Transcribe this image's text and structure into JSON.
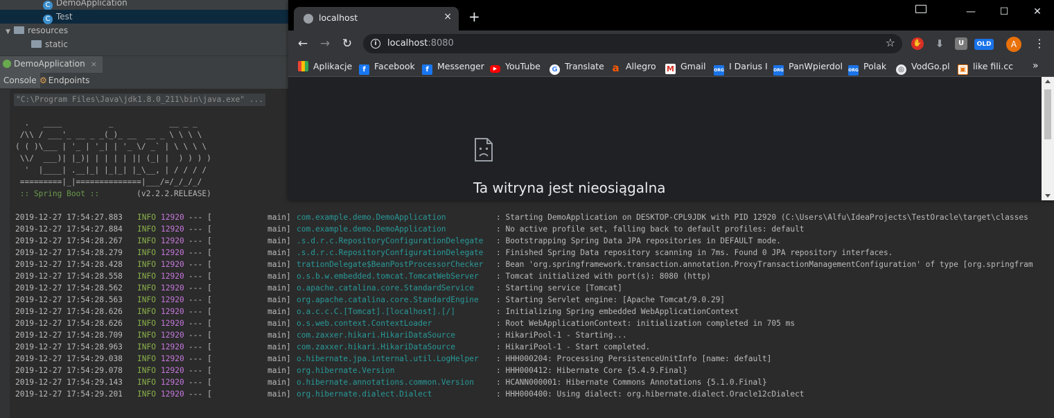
{
  "ide": {
    "project_tree": [
      {
        "label": "DemoApplication",
        "type": "class"
      },
      {
        "label": "Test",
        "type": "class",
        "selected": true
      },
      {
        "label": "resources",
        "type": "folder",
        "expanded": true
      },
      {
        "label": "static",
        "type": "folder"
      }
    ],
    "run_tab": {
      "label": "DemoApplication",
      "close": "×"
    },
    "tool_tabs": {
      "console": "Console",
      "endpoints": "Endpoints"
    },
    "console": {
      "command": "\"C:\\Program Files\\Java\\jdk1.8.0_211\\bin\\java.exe\" ...",
      "banner": [
        "  .   ____          _            __ _ _",
        " /\\\\ / ___'_ __ _ _(_)_ __  __ _ \\ \\ \\ \\",
        "( ( )\\___ | '_ | '_| | '_ \\/ _` | \\ \\ \\ \\",
        " \\\\/  ___)| |_)| | | | | || (_| |  ) ) ) )",
        "  '  |____| .__|_| |_|_| |_\\__, | / / / /",
        " =========|_|==============|___/=/_/_/_/"
      ],
      "spring_label": " :: Spring Boot :: ",
      "spring_version": "       (v2.2.2.RELEASE)",
      "logs": [
        {
          "ts": "2019-12-27 17:54:27.883",
          "level": "INFO",
          "pid": "12920",
          "sep": "--- [",
          "thread": "main]",
          "logger": "com.example.demo.DemoApplication",
          "msg": ": Starting DemoApplication on DESKTOP-CPL9JDK with PID 12920 (C:\\Users\\Alfu\\IdeaProjects\\TestOracle\\target\\classes"
        },
        {
          "ts": "2019-12-27 17:54:27.884",
          "level": "INFO",
          "pid": "12920",
          "sep": "--- [",
          "thread": "main]",
          "logger": "com.example.demo.DemoApplication",
          "msg": ": No active profile set, falling back to default profiles: default"
        },
        {
          "ts": "2019-12-27 17:54:28.267",
          "level": "INFO",
          "pid": "12920",
          "sep": "--- [",
          "thread": "main]",
          "logger": ".s.d.r.c.RepositoryConfigurationDelegate",
          "msg": ": Bootstrapping Spring Data JPA repositories in DEFAULT mode."
        },
        {
          "ts": "2019-12-27 17:54:28.279",
          "level": "INFO",
          "pid": "12920",
          "sep": "--- [",
          "thread": "main]",
          "logger": ".s.d.r.c.RepositoryConfigurationDelegate",
          "msg": ": Finished Spring Data repository scanning in 7ms. Found 0 JPA repository interfaces."
        },
        {
          "ts": "2019-12-27 17:54:28.428",
          "level": "INFO",
          "pid": "12920",
          "sep": "--- [",
          "thread": "main]",
          "logger": "trationDelegate$BeanPostProcessorChecker",
          "msg": ": Bean 'org.springframework.transaction.annotation.ProxyTransactionManagementConfiguration' of type [org.springfram"
        },
        {
          "ts": "2019-12-27 17:54:28.558",
          "level": "INFO",
          "pid": "12920",
          "sep": "--- [",
          "thread": "main]",
          "logger": "o.s.b.w.embedded.tomcat.TomcatWebServer",
          "msg": ": Tomcat initialized with port(s): 8080 (http)"
        },
        {
          "ts": "2019-12-27 17:54:28.562",
          "level": "INFO",
          "pid": "12920",
          "sep": "--- [",
          "thread": "main]",
          "logger": "o.apache.catalina.core.StandardService",
          "msg": ": Starting service [Tomcat]"
        },
        {
          "ts": "2019-12-27 17:54:28.563",
          "level": "INFO",
          "pid": "12920",
          "sep": "--- [",
          "thread": "main]",
          "logger": "org.apache.catalina.core.StandardEngine",
          "msg": ": Starting Servlet engine: [Apache Tomcat/9.0.29]"
        },
        {
          "ts": "2019-12-27 17:54:28.626",
          "level": "INFO",
          "pid": "12920",
          "sep": "--- [",
          "thread": "main]",
          "logger": "o.a.c.c.C.[Tomcat].[localhost].[/]",
          "msg": ": Initializing Spring embedded WebApplicationContext"
        },
        {
          "ts": "2019-12-27 17:54:28.626",
          "level": "INFO",
          "pid": "12920",
          "sep": "--- [",
          "thread": "main]",
          "logger": "o.s.web.context.ContextLoader",
          "msg": ": Root WebApplicationContext: initialization completed in 705 ms"
        },
        {
          "ts": "2019-12-27 17:54:28.709",
          "level": "INFO",
          "pid": "12920",
          "sep": "--- [",
          "thread": "main]",
          "logger": "com.zaxxer.hikari.HikariDataSource",
          "msg": ": HikariPool-1 - Starting..."
        },
        {
          "ts": "2019-12-27 17:54:28.963",
          "level": "INFO",
          "pid": "12920",
          "sep": "--- [",
          "thread": "main]",
          "logger": "com.zaxxer.hikari.HikariDataSource",
          "msg": ": HikariPool-1 - Start completed."
        },
        {
          "ts": "2019-12-27 17:54:29.038",
          "level": "INFO",
          "pid": "12920",
          "sep": "--- [",
          "thread": "main]",
          "logger": "o.hibernate.jpa.internal.util.LogHelper",
          "msg": ": HHH000204: Processing PersistenceUnitInfo [name: default]"
        },
        {
          "ts": "2019-12-27 17:54:29.078",
          "level": "INFO",
          "pid": "12920",
          "sep": "--- [",
          "thread": "main]",
          "logger": "org.hibernate.Version",
          "msg": ": HHH000412: Hibernate Core {5.4.9.Final}"
        },
        {
          "ts": "2019-12-27 17:54:29.143",
          "level": "INFO",
          "pid": "12920",
          "sep": "--- [",
          "thread": "main]",
          "logger": "o.hibernate.annotations.common.Version",
          "msg": ": HCANN000001: Hibernate Commons Annotations {5.1.0.Final}"
        },
        {
          "ts": "2019-12-27 17:54:29.201",
          "level": "INFO",
          "pid": "12920",
          "sep": "--- [",
          "thread": "main]",
          "logger": "org.hibernate.dialect.Dialect",
          "msg": ": HHH000400: Using dialect: org.hibernate.dialect.Oracle12cDialect"
        }
      ]
    }
  },
  "browser": {
    "tab_title": "localhost",
    "tab_close": "×",
    "new_tab": "+",
    "window_buttons": {
      "minimize": "—",
      "maximize": "☐",
      "close": "✕"
    },
    "url_host": "localhost",
    "url_port": ":8080",
    "bookmarks": [
      {
        "label": "Aplikacje",
        "icon": "apps-grid-icon"
      },
      {
        "label": "Facebook",
        "icon": "facebook-icon"
      },
      {
        "label": "Messenger",
        "icon": "facebook-icon"
      },
      {
        "label": "YouTube",
        "icon": "youtube-icon"
      },
      {
        "label": "Translate",
        "icon": "google-icon"
      },
      {
        "label": "Allegro",
        "icon": "allegro-icon"
      },
      {
        "label": "Gmail",
        "icon": "gmail-icon"
      },
      {
        "label": "I Darius I",
        "icon": "bookmark-site-icon"
      },
      {
        "label": "PanWpierdol",
        "icon": "bookmark-site-icon"
      },
      {
        "label": "Polak",
        "icon": "bookmark-site-icon"
      },
      {
        "label": "VodGo.pl",
        "icon": "globe-icon"
      },
      {
        "label": "like fili.cc",
        "icon": "bookmark-site-icon"
      }
    ],
    "bookmarks_more": "»",
    "avatar_letter": "A",
    "extensions": {
      "old_badge": "OLD",
      "u_badge": "U"
    },
    "error_title": "Ta witryna jest nieosiągalna"
  },
  "colors": {
    "ide_bg": "#2b2b2b",
    "log_level": "#8ab04a",
    "log_pid": "#c678dd",
    "logger": "#299999",
    "chrome_dark": "#35363a",
    "avatar": "#e8710a"
  }
}
